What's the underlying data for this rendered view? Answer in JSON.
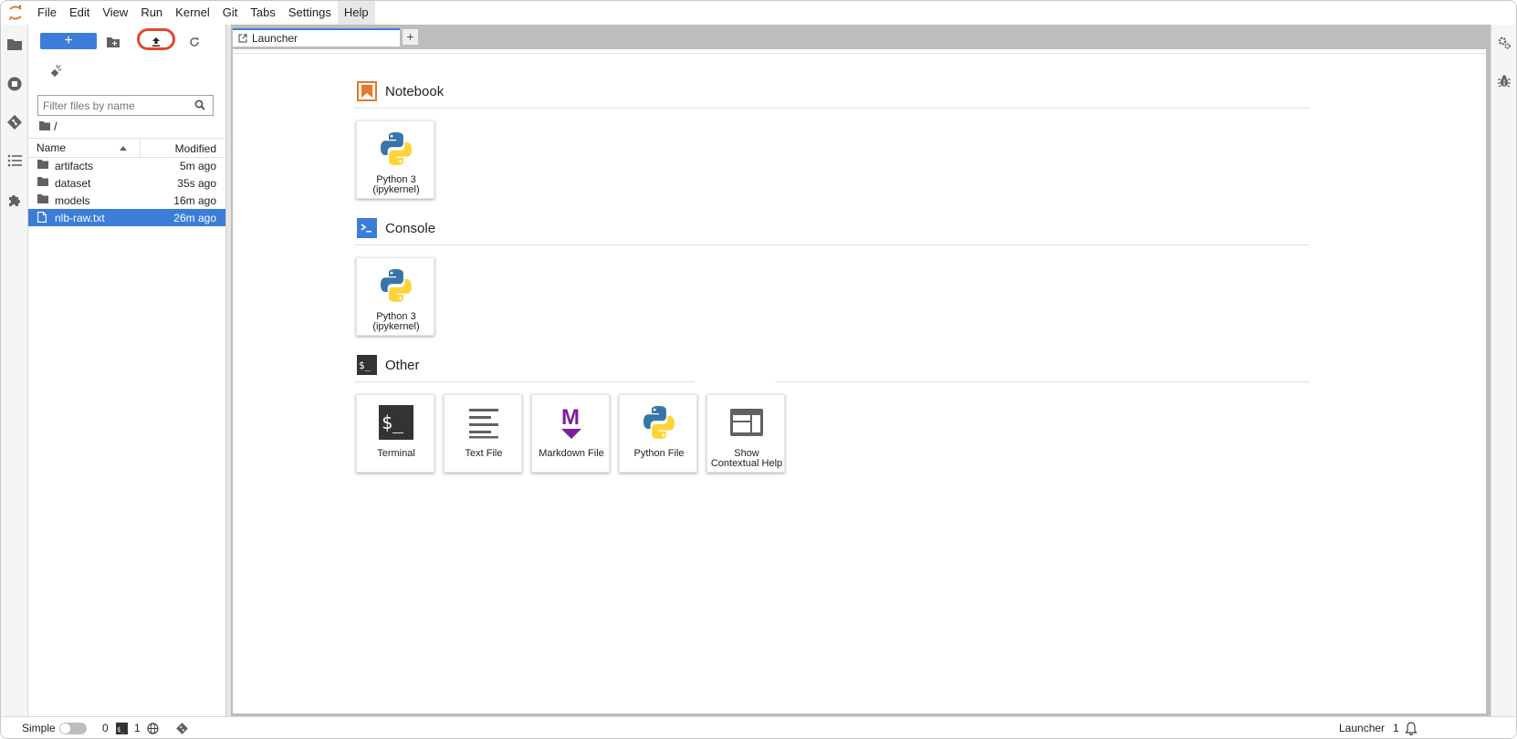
{
  "menubar": {
    "items": [
      "File",
      "Edit",
      "View",
      "Run",
      "Kernel",
      "Git",
      "Tabs",
      "Settings",
      "Help"
    ],
    "active": "Help"
  },
  "left_sidebar_icons": [
    "folder-icon",
    "stop-circle-icon",
    "git-icon",
    "table-of-contents-icon",
    "extension-icon"
  ],
  "file_browser": {
    "new_button_label": "+",
    "filter_placeholder": "Filter files by name",
    "breadcrumb": "/",
    "columns": {
      "name": "Name",
      "modified": "Modified"
    },
    "files": [
      {
        "name": "artifacts",
        "modified": "5m ago",
        "type": "folder",
        "selected": false
      },
      {
        "name": "dataset",
        "modified": "35s ago",
        "type": "folder",
        "selected": false
      },
      {
        "name": "models",
        "modified": "16m ago",
        "type": "folder",
        "selected": false
      },
      {
        "name": "nlb-raw.txt",
        "modified": "26m ago",
        "type": "file",
        "selected": true
      }
    ],
    "highlighted_button": "upload-button"
  },
  "tabs": [
    {
      "label": "Launcher",
      "active": true
    }
  ],
  "tab_add_label": "+",
  "launcher": {
    "sections": [
      {
        "title": "Notebook",
        "cards": [
          {
            "label": "Python 3\n(ipykernel)",
            "icon": "python-icon"
          }
        ]
      },
      {
        "title": "Console",
        "cards": [
          {
            "label": "Python 3\n(ipykernel)",
            "icon": "python-icon"
          }
        ]
      },
      {
        "title": "Other",
        "cards": [
          {
            "label": "Terminal",
            "icon": "terminal-icon"
          },
          {
            "label": "Text File",
            "icon": "text-file-icon"
          },
          {
            "label": "Markdown File",
            "icon": "markdown-icon"
          },
          {
            "label": "Python File",
            "icon": "python-icon"
          },
          {
            "label": "Show\nContextual Help",
            "icon": "contextual-help-icon"
          }
        ]
      }
    ]
  },
  "statusbar": {
    "mode_label": "Simple",
    "simple_mode_on": false,
    "kernels_count": "0",
    "terminals_count": "1",
    "right_label": "Launcher",
    "notifications_count": "1"
  },
  "colors": {
    "accent": "#3b7dd8",
    "highlight_ring": "#e4472e",
    "notebook_orange": "#e8762d",
    "markdown_purple": "#7b1fa2"
  }
}
